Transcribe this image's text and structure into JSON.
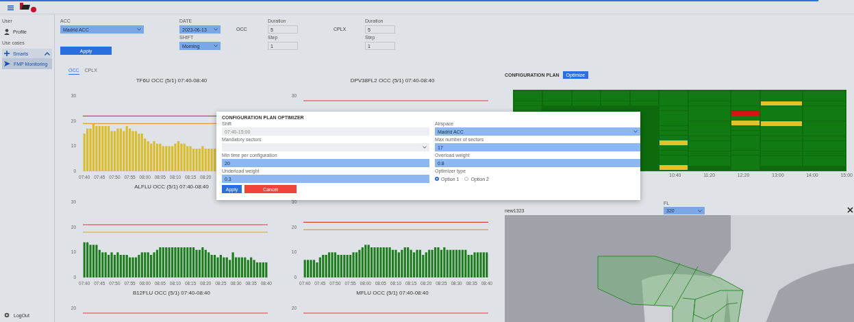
{
  "sidebar": {
    "sections": [
      {
        "heading": "User",
        "items": [
          {
            "label": "Profile",
            "kind": "profile",
            "selected": false
          }
        ]
      },
      {
        "heading": "Use cases",
        "items": [
          {
            "label": "Smarts",
            "kind": "group",
            "selected": false,
            "expanded": true,
            "children": [
              {
                "label": "FMP Monitoring",
                "kind": "plane",
                "selected": true
              }
            ]
          }
        ]
      }
    ],
    "logout": "LogOut"
  },
  "filters": {
    "acc": {
      "label": "ACC",
      "value": "Madrid ACC"
    },
    "date": {
      "label": "DATE",
      "value": "2023-06-13"
    },
    "shift": {
      "label": "SHIFT",
      "value": "Morning"
    },
    "occ": {
      "label": "OCC",
      "duration_label": "Duration",
      "duration": "5",
      "step_label": "Step",
      "step": "1"
    },
    "cplx": {
      "label": "CPLX",
      "duration_label": "Duration",
      "duration": "5",
      "step_label": "Step",
      "step": "1"
    },
    "apply": "Apply"
  },
  "tabs": [
    {
      "label": "OCC",
      "selected": true
    },
    {
      "label": "CPLX",
      "selected": false
    }
  ],
  "charts": [
    {
      "chart_data": {
        "type": "bar",
        "title": "TF6U OCC (5/1) 07:40-08:40",
        "ylim": [
          0,
          30
        ],
        "yticks": [
          0,
          10,
          20,
          30
        ],
        "categories": [
          "07:40",
          null,
          null,
          null,
          null,
          "07:45",
          null,
          null,
          null,
          null,
          "07:50",
          null,
          null,
          null,
          null,
          "07:55",
          null,
          null,
          null,
          null,
          "08:00",
          null,
          null,
          null,
          null,
          "08:05",
          null,
          null,
          null,
          null,
          "08:10",
          null,
          null,
          null,
          null,
          "08:15",
          null,
          null,
          null,
          null,
          "08:20",
          null,
          null,
          null
        ],
        "series": [
          {
            "color": "#d9bd2b",
            "values": [
              15,
              17,
              17,
              19,
              18,
              18,
              18,
              18,
              18,
              16,
              16,
              17,
              17,
              16,
              18,
              17,
              16,
              16,
              15,
              15,
              13,
              12,
              11,
              12,
              11,
              11,
              10,
              10,
              10,
              10,
              11,
              12,
              11,
              11,
              10,
              10,
              9,
              9,
              9,
              10,
              9,
              9,
              9,
              9
            ]
          }
        ],
        "ref_lines": [
          {
            "axis": "y",
            "value": 22,
            "color": "#e53935"
          },
          {
            "axis": "y",
            "value": 19,
            "color": "#e0a030"
          }
        ]
      }
    },
    {
      "chart_data": {
        "type": "other",
        "title": "DPV38FL2 OCC (5/1) 07:40-08:40",
        "annotations": [
          {
            "text": "30"
          }
        ]
      }
    },
    {
      "chart_data": {
        "type": "bar",
        "title": "ALFLU OCC (5/1) 07:40-08:40",
        "ylim": [
          0,
          30
        ],
        "yticks": [
          0,
          10,
          20,
          30
        ],
        "categories": [
          "07:40",
          null,
          null,
          null,
          null,
          "07:45",
          null,
          null,
          null,
          null,
          "07:50",
          null,
          null,
          null,
          null,
          "07:55",
          null,
          null,
          null,
          null,
          "08:00",
          null,
          null,
          null,
          null,
          "08:05",
          null,
          null,
          null,
          null,
          "08:10",
          null,
          null,
          null,
          null,
          "08:15",
          null,
          null,
          null,
          null,
          "08:20",
          null,
          null,
          null,
          null,
          "08:25",
          null,
          null,
          null,
          null,
          "08:30",
          null,
          null,
          null,
          null,
          "08:35",
          null,
          null,
          null,
          null,
          "08:40"
        ],
        "series": [
          {
            "color": "#1e7d1e",
            "values": [
              14,
              14,
              13,
              13,
              13,
              11,
              10,
              10,
              9,
              10,
              9,
              10,
              9,
              9,
              9,
              8,
              8,
              8,
              9,
              10,
              10,
              10,
              9,
              10,
              11,
              12,
              12,
              12,
              12,
              12,
              12,
              12,
              12,
              12,
              12,
              12,
              12,
              11,
              11,
              12,
              11,
              10,
              9,
              9,
              8,
              9,
              8,
              8,
              7,
              10,
              8,
              8,
              8,
              8,
              7,
              8,
              7,
              6,
              6,
              6,
              6
            ]
          }
        ],
        "ref_lines": [
          {
            "axis": "y",
            "value": 21,
            "color": "#e53935"
          },
          {
            "axis": "y",
            "value": 18,
            "color": "#e0a030"
          }
        ]
      }
    },
    {
      "chart_data": {
        "type": "bar",
        "ylim": [
          0,
          30
        ],
        "yticks": [
          0,
          10,
          20,
          30
        ],
        "categories": [
          "07:40",
          null,
          null,
          null,
          null,
          "07:45",
          null,
          null,
          null,
          null,
          "07:50",
          null,
          null,
          null,
          null,
          "07:55",
          null,
          null,
          null,
          null,
          "08:00",
          null,
          null,
          null,
          null,
          "08:05",
          null,
          null,
          null,
          null,
          "08:10",
          null,
          null,
          null,
          null,
          "08:15",
          null,
          null,
          null,
          null,
          "08:20",
          null,
          null,
          null,
          null,
          "08:25",
          null,
          null,
          null,
          null,
          "08:30",
          null,
          null,
          null,
          null,
          "08:35",
          null,
          null,
          null,
          null,
          "08:40"
        ],
        "series": [
          {
            "color": "#1e7d1e",
            "values": [
              7,
              7,
              7,
              7,
              6,
              8,
              9,
              9,
              10,
              10,
              10,
              9,
              9,
              9,
              9,
              9,
              10,
              10,
              11,
              12,
              13,
              13,
              12,
              12,
              12,
              12,
              12,
              12,
              12,
              11,
              11,
              10,
              11,
              12,
              12,
              11,
              10,
              11,
              11,
              9,
              10,
              11,
              11,
              12,
              12,
              11,
              12,
              11,
              11,
              11,
              11,
              11,
              11,
              11,
              9,
              9,
              10,
              10,
              10,
              10,
              10
            ]
          }
        ],
        "ref_lines": [
          {
            "axis": "y",
            "value": 22,
            "color": "#e53935"
          },
          {
            "axis": "y",
            "value": 19,
            "color": "#e0a030"
          }
        ]
      }
    },
    {
      "chart_data": {
        "type": "other",
        "title": "B12FLU OCC (5/1) 07:40-08:40",
        "annotations": [
          {
            "text": "20"
          }
        ]
      }
    },
    {
      "chart_data": {
        "type": "other",
        "title": "MFLU OCC (5/1) 07:40-08:40",
        "annotations": [
          {
            "text": "20"
          }
        ]
      }
    }
  ],
  "configuration_plan": {
    "title": "CONFIGURATION PLAN",
    "optimize": "Optimize",
    "columns": [
      {
        "cells": [
          {
            "color": "#127a12"
          },
          {
            "color": "#127a12"
          },
          {
            "color": "#127a12"
          },
          {
            "color": "#127a12"
          }
        ]
      },
      {
        "cells": [
          {
            "color": "#127a12"
          },
          {
            "color": "#127a12"
          },
          {
            "color": "#127a12"
          }
        ]
      },
      {
        "cells": [
          {
            "color": "#127a12"
          },
          {
            "color": "#127a12"
          },
          {
            "color": "#127a12"
          }
        ]
      },
      {
        "cells": [
          {
            "color": "#127a12"
          },
          {
            "color": "#127a12"
          },
          {
            "color": "#127a12"
          }
        ]
      },
      {
        "cells": [
          {
            "color": "#127a12"
          },
          {
            "color": "#127a12"
          },
          {
            "color": "#127a12"
          }
        ]
      },
      {
        "cells": [
          {
            "color": "#127a12"
          },
          {
            "color": "#127a12"
          },
          {
            "color": "#127a12"
          },
          {
            "color": "#127a12"
          },
          {
            "color": "#127a12"
          },
          {
            "color": "#127a12"
          },
          {
            "color": "#127a12"
          },
          {
            "color": "#127a12"
          },
          {
            "color": "#127a12"
          },
          {
            "color": "#127a12"
          },
          {
            "color": "#e2c226"
          },
          {
            "color": "#127a12"
          },
          {
            "color": "#127a12"
          },
          {
            "color": "#127a12"
          },
          {
            "color": "#127a12"
          },
          {
            "color": "#e2c226"
          }
        ]
      },
      {
        "cells": [
          {
            "color": "#127a12"
          },
          {
            "color": "#127a12"
          },
          {
            "color": "#127a12"
          },
          {
            "color": "#127a12"
          },
          {
            "color": "#127a12"
          },
          {
            "color": "#127a12"
          },
          {
            "color": "#127a12"
          },
          {
            "color": "#127a12"
          },
          {
            "color": "#127a12"
          },
          {
            "color": "#127a12"
          },
          {
            "color": "#127a12"
          },
          {
            "color": "#127a12"
          },
          {
            "color": "#127a12"
          },
          {
            "color": "#127a12"
          },
          {
            "color": "#127a12"
          }
        ]
      },
      {
        "cells": [
          {
            "color": "#127a12"
          },
          {
            "color": "#127a12"
          },
          {
            "color": "#127a12"
          },
          {
            "color": "#127a12"
          },
          {
            "color": "#d41414"
          },
          {
            "color": "#127a12"
          },
          {
            "color": "#e2c226"
          },
          {
            "color": "#127a12"
          },
          {
            "color": "#127a12"
          },
          {
            "color": "#127a12"
          },
          {
            "color": "#127a12"
          },
          {
            "color": "#127a12"
          },
          {
            "color": "#127a12"
          },
          {
            "color": "#127a12"
          },
          {
            "color": "#127a12"
          },
          {
            "color": "#127a12"
          }
        ]
      },
      {
        "cells": [
          {
            "color": "#127a12"
          },
          {
            "color": "#127a12"
          },
          {
            "color": "#e2c226"
          },
          {
            "color": "#127a12"
          },
          {
            "color": "#127a12"
          },
          {
            "color": "#127a12"
          },
          {
            "color": "#e2c226"
          },
          {
            "color": "#127a12"
          },
          {
            "color": "#127a12"
          },
          {
            "color": "#127a12"
          },
          {
            "color": "#127a12"
          },
          {
            "color": "#127a12"
          },
          {
            "color": "#127a12"
          },
          {
            "color": "#127a12"
          },
          {
            "color": "#127a12"
          }
        ]
      },
      {
        "cells": [
          {
            "color": "#127a12"
          },
          {
            "color": "#127a12"
          },
          {
            "color": "#127a12"
          },
          {
            "color": "#127a12"
          },
          {
            "color": "#127a12"
          },
          {
            "color": "#127a12"
          },
          {
            "color": "#127a12"
          },
          {
            "color": "#127a12"
          },
          {
            "color": "#127a12"
          },
          {
            "color": "#127a12"
          },
          {
            "color": "#127a12"
          },
          {
            "color": "#127a12"
          },
          {
            "color": "#127a12"
          },
          {
            "color": "#127a12"
          },
          {
            "color": "#127a12"
          }
        ]
      }
    ],
    "times": [
      "10:40",
      "11:20",
      "12:20",
      "13:00",
      "14:00",
      "15:00"
    ]
  },
  "sector_map": {
    "title": "new1323",
    "fl_label": "FL",
    "fl_value": "320"
  },
  "dialog": {
    "title": "CONFIGURATION PLAN OPTIMIZER",
    "fields": [
      {
        "label": "Shift",
        "value": "07:40-15:00",
        "kind": "text",
        "disabled": true
      },
      {
        "label": "Airspace",
        "value": "Madrid ACC",
        "kind": "select",
        "disabled": false
      },
      {
        "label": "Mandatory sectors",
        "kind": "select",
        "disabled": true
      },
      {
        "label": "Max number of sectors",
        "value": "17",
        "kind": "text",
        "disabled": false
      },
      {
        "label": "Min time per configuration",
        "value": "20",
        "kind": "text",
        "disabled": false
      },
      {
        "label": "Overload weight",
        "value": "0.8",
        "kind": "text",
        "disabled": false
      },
      {
        "label": "Underload weight",
        "value": "0.3",
        "kind": "text",
        "disabled": false
      },
      {
        "label": "Optimizer type",
        "kind": "radio",
        "options": [
          {
            "label": "Option 1",
            "selected": true
          },
          {
            "label": "Option 2",
            "selected": false
          }
        ]
      }
    ],
    "apply": "Apply",
    "cancel": "Cancel"
  }
}
